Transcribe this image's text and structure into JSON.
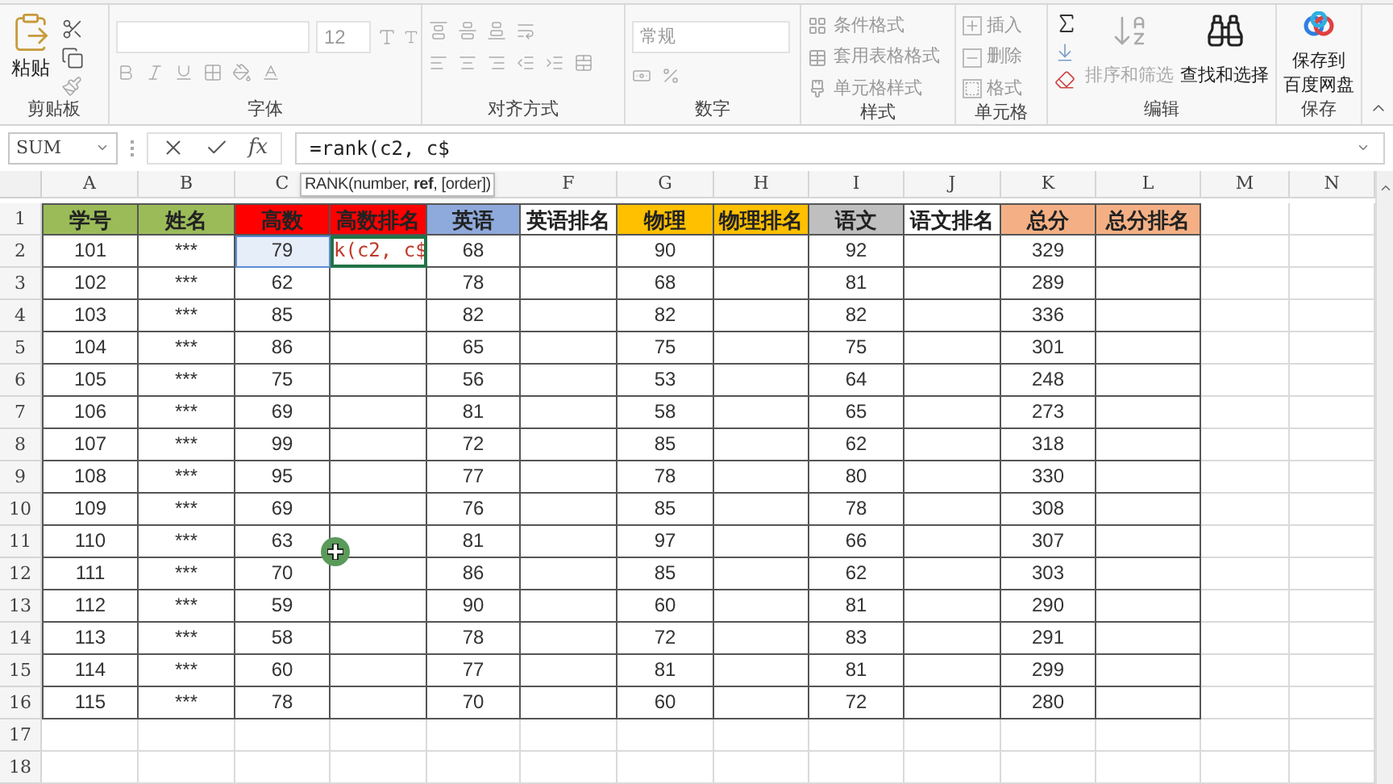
{
  "ribbon": {
    "groups": [
      {
        "kind": "clipboard",
        "label": "剪贴板",
        "paste": "粘贴"
      },
      {
        "kind": "font",
        "label": "字体",
        "font_size": "12"
      },
      {
        "kind": "alignment",
        "label": "对齐方式"
      },
      {
        "kind": "number",
        "label": "数字",
        "format": "常规"
      },
      {
        "kind": "styles",
        "label": "样式",
        "items": [
          "条件格式",
          "套用表格格式",
          "单元格样式"
        ]
      },
      {
        "kind": "cells",
        "label": "单元格",
        "items": [
          "插入",
          "删除",
          "格式"
        ]
      },
      {
        "kind": "editing",
        "label": "编辑",
        "buttons": [
          {
            "label": "排序和筛选",
            "disabled": true
          },
          {
            "label": "查找和选择",
            "disabled": false
          }
        ]
      },
      {
        "kind": "save",
        "label": "保存",
        "button_lines": [
          "保存到",
          "百度网盘"
        ]
      }
    ]
  },
  "formula_bar": {
    "name_box": "SUM",
    "function_label": "fx",
    "formula": "=rank(c2, c$"
  },
  "tooltip": "RANK(number, **ref**, [order])",
  "sheet": {
    "columns": [
      "A",
      "B",
      "C",
      null,
      null,
      "F",
      "G",
      "H",
      "I",
      "J",
      "K",
      "L",
      "M",
      "N"
    ],
    "header_row": {
      "row": "1",
      "cells": [
        {
          "text": "学号",
          "color": "#9bbb59"
        },
        {
          "text": "姓名",
          "color": "#9bbb59"
        },
        {
          "text": "高数",
          "color": "#ff0000"
        },
        {
          "text": "高数排名",
          "color": "#ff0000"
        },
        {
          "text": "英语",
          "color": "#8ea9db"
        },
        {
          "text": "英语排名",
          "color": "#ffffff"
        },
        {
          "text": "物理",
          "color": "#ffc000"
        },
        {
          "text": "物理排名",
          "color": "#ffc000"
        },
        {
          "text": "语文",
          "color": "#bfbfbf"
        },
        {
          "text": "语文排名",
          "color": "#ffffff"
        },
        {
          "text": "总分",
          "color": "#f4b084"
        },
        {
          "text": "总分排名",
          "color": "#f4b084"
        }
      ]
    },
    "rows": [
      {
        "row": "2",
        "cells": [
          "101",
          "***",
          {
            "text": "79",
            "kind": "reference"
          },
          {
            "text": "k(c2, c$",
            "kind": "editing"
          },
          "68",
          null,
          "90",
          null,
          "92",
          null,
          "329",
          null
        ]
      },
      {
        "row": "3",
        "cells": [
          "102",
          "***",
          "62",
          null,
          "78",
          null,
          "68",
          null,
          "81",
          null,
          "289",
          null
        ]
      },
      {
        "row": "4",
        "cells": [
          "103",
          "***",
          "85",
          null,
          "82",
          null,
          "82",
          null,
          "82",
          null,
          "336",
          null
        ]
      },
      {
        "row": "5",
        "cells": [
          "104",
          "***",
          "86",
          null,
          "65",
          null,
          "75",
          null,
          "75",
          null,
          "301",
          null
        ]
      },
      {
        "row": "6",
        "cells": [
          "105",
          "***",
          "75",
          null,
          "56",
          null,
          "53",
          null,
          "64",
          null,
          "248",
          null
        ]
      },
      {
        "row": "7",
        "cells": [
          "106",
          "***",
          "69",
          null,
          "81",
          null,
          "58",
          null,
          "65",
          null,
          "273",
          null
        ]
      },
      {
        "row": "8",
        "cells": [
          "107",
          "***",
          "99",
          null,
          "72",
          null,
          "85",
          null,
          "62",
          null,
          "318",
          null
        ]
      },
      {
        "row": "9",
        "cells": [
          "108",
          "***",
          "95",
          null,
          "77",
          null,
          "78",
          null,
          "80",
          null,
          "330",
          null
        ]
      },
      {
        "row": "10",
        "cells": [
          "109",
          "***",
          "69",
          null,
          "76",
          null,
          "85",
          null,
          "78",
          null,
          "308",
          null
        ]
      },
      {
        "row": "11",
        "cells": [
          "110",
          "***",
          "63",
          null,
          "81",
          null,
          "97",
          null,
          "66",
          null,
          "307",
          null
        ]
      },
      {
        "row": "12",
        "cells": [
          "111",
          "***",
          "70",
          null,
          "86",
          null,
          "85",
          null,
          "62",
          null,
          "303",
          null
        ]
      },
      {
        "row": "13",
        "cells": [
          "112",
          "***",
          "59",
          null,
          "90",
          null,
          "60",
          null,
          "81",
          null,
          "290",
          null
        ]
      },
      {
        "row": "14",
        "cells": [
          "113",
          "***",
          "58",
          null,
          "78",
          null,
          "72",
          null,
          "83",
          null,
          "291",
          null
        ]
      },
      {
        "row": "15",
        "cells": [
          "114",
          "***",
          "60",
          null,
          "77",
          null,
          "81",
          null,
          "81",
          null,
          "299",
          null
        ]
      },
      {
        "row": "16",
        "cells": [
          "115",
          "***",
          "78",
          null,
          "70",
          null,
          "60",
          null,
          "72",
          null,
          "280",
          null
        ]
      }
    ],
    "empty_rows": [
      "17",
      "18"
    ]
  }
}
